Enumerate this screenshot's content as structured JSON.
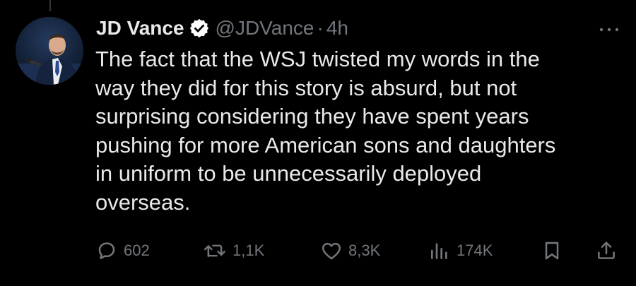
{
  "author": {
    "name": "JD Vance",
    "handle": "@JDVance",
    "separator": "·",
    "time": "4h",
    "verified_color": "#ffffff"
  },
  "tweet": {
    "lines": [
      "The fact that the WSJ twisted my words in the",
      "way they did for this story is absurd, but not",
      "surprising considering they have spent years",
      "pushing for more American sons and daughters",
      "in uniform to be unnecessarily deployed",
      "overseas."
    ]
  },
  "actions": {
    "reply": {
      "icon": "reply-icon",
      "count": "602"
    },
    "repost": {
      "icon": "repost-icon",
      "count": "1,1K"
    },
    "like": {
      "icon": "heart-icon",
      "count": "8,3K"
    },
    "views": {
      "icon": "views-icon",
      "count": "174K"
    },
    "bookmark": {
      "icon": "bookmark-icon"
    },
    "share": {
      "icon": "share-icon"
    }
  },
  "colors": {
    "background": "#000000",
    "text_primary": "#e7e9ea",
    "text_secondary": "#71767b"
  }
}
